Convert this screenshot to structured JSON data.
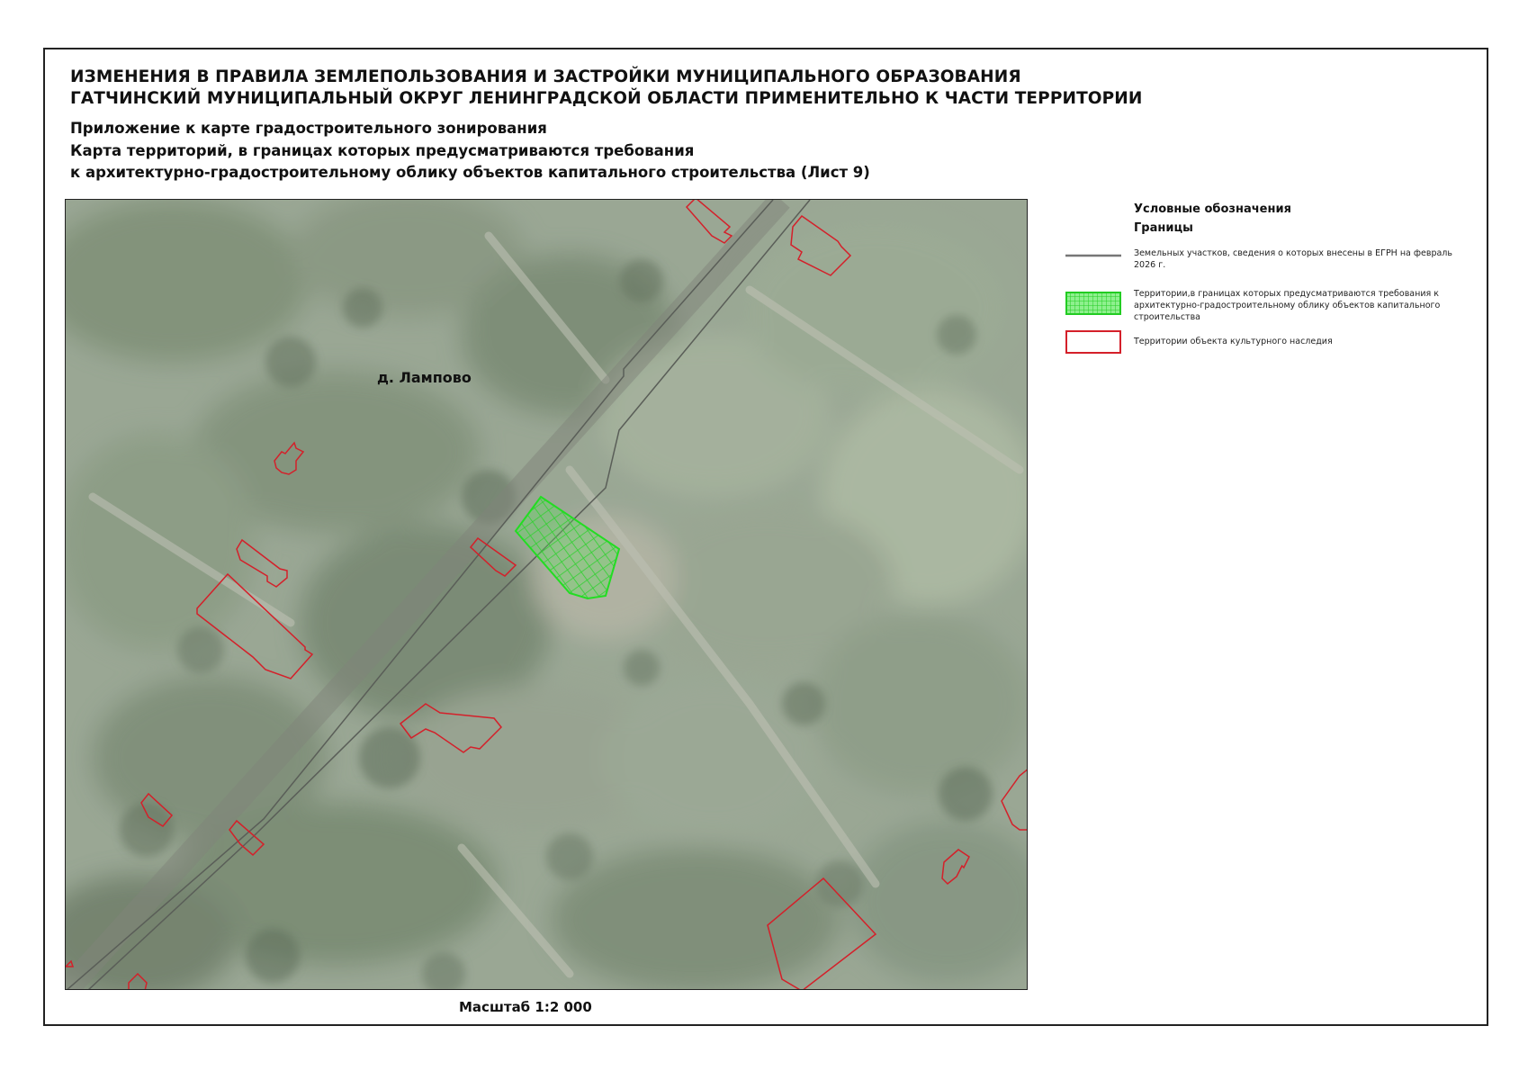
{
  "header": {
    "title_line1": "ИЗМЕНЕНИЯ В ПРАВИЛА ЗЕМЛЕПОЛЬЗОВАНИЯ И ЗАСТРОЙКИ МУНИЦИПАЛЬНОГО ОБРАЗОВАНИЯ",
    "title_line2": "ГАТЧИНСКИЙ МУНИЦИПАЛЬНЫЙ ОКРУГ ЛЕНИНГРАДСКОЙ ОБЛАСТИ ПРИМЕНИТЕЛЬНО К ЧАСТИ ТЕРРИТОРИИ",
    "subtitle_line1": "Приложение к карте градостроительного зонирования",
    "subtitle_line2": "Карта территорий, в границах которых предусматриваются требования",
    "subtitle_line3": "к архитектурно-градостроительному облику объектов капитального строительства (Лист 9)"
  },
  "map": {
    "place_label": "д. Лампово",
    "scale_label": "Масштаб 1:2 000"
  },
  "legend": {
    "title": "Условные обозначения",
    "subtitle": "Границы",
    "items": [
      {
        "symbol": "gray-line-icon",
        "text": "Земельных участков, сведения о которых внесены в ЕГРН на февраль 2026 г."
      },
      {
        "symbol": "green-grid-icon",
        "text": "Территории,в границах которых предусматриваются требования к архитектурно-градостроительному облику объектов капитального строительства"
      },
      {
        "symbol": "red-outline-icon",
        "text": "Территории объекта культурного наследия"
      }
    ]
  },
  "colors": {
    "heritage_outline": "#d4202a",
    "requirement_zone": "#33dd33",
    "parcel_line": "#555555"
  }
}
